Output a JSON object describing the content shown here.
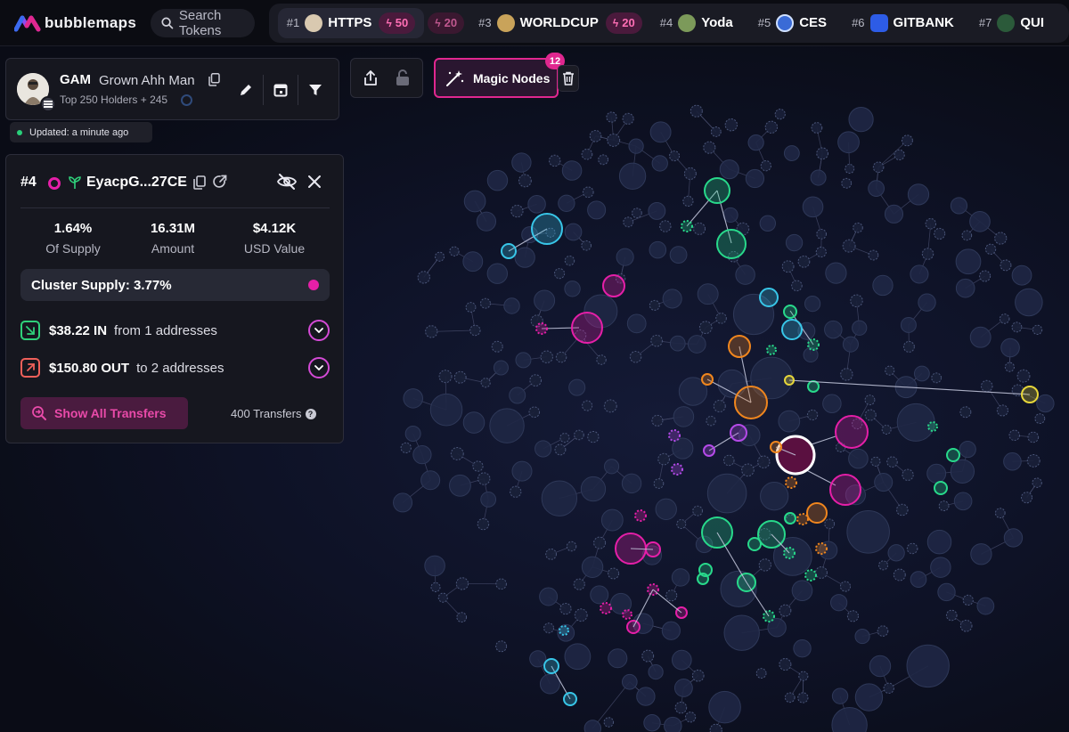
{
  "app": {
    "name": "bubblemaps",
    "search_placeholder": "Search Tokens"
  },
  "ticker": [
    {
      "rank": "#1",
      "name": "HTTPS",
      "boost": "50",
      "boost2": "20",
      "color": "#d9c9b0"
    },
    {
      "rank": "#3",
      "name": "WORLDCUP",
      "boost": "20",
      "color": "#c9a35a"
    },
    {
      "rank": "#4",
      "name": "Yoda",
      "color": "#7c9a5a"
    },
    {
      "rank": "#5",
      "name": "CES",
      "color": "#3a6bd6"
    },
    {
      "rank": "#6",
      "name": "GITBANK",
      "color": "#2d5ce6"
    },
    {
      "rank": "#7",
      "name": "QUI",
      "color": "#2b5a3a"
    }
  ],
  "token": {
    "symbol": "GAM",
    "name": "Grown Ahh Man",
    "subtitle": "Top 250 Holders + 245",
    "updated": "Updated: a minute ago"
  },
  "toolbar": {
    "magic_label": "Magic Nodes",
    "magic_count": "12"
  },
  "holder": {
    "rank": "#4",
    "address": "EyacpG...27CE",
    "stats": [
      {
        "value": "1.64%",
        "label": "Of Supply"
      },
      {
        "value": "16.31M",
        "label": "Amount"
      },
      {
        "value": "$4.12K",
        "label": "USD Value"
      }
    ],
    "cluster_supply": "Cluster Supply: 3.77%",
    "in_amount": "$38.22 IN",
    "in_text": "from 1 addresses",
    "out_amount": "$150.80 OUT",
    "out_text": "to 2 addresses",
    "show_transfers": "Show All Transfers",
    "transfers_count": "400 Transfers"
  },
  "colors": {
    "accent": "#e0278f",
    "cluster_pink": "#e51fa8",
    "cluster_green": "#28d98b",
    "cluster_cyan": "#38c6e8",
    "cluster_orange": "#f0861e",
    "cluster_yellow": "#e6d63a",
    "cluster_purple": "#b44ae8",
    "node_default": "#1d2440"
  }
}
